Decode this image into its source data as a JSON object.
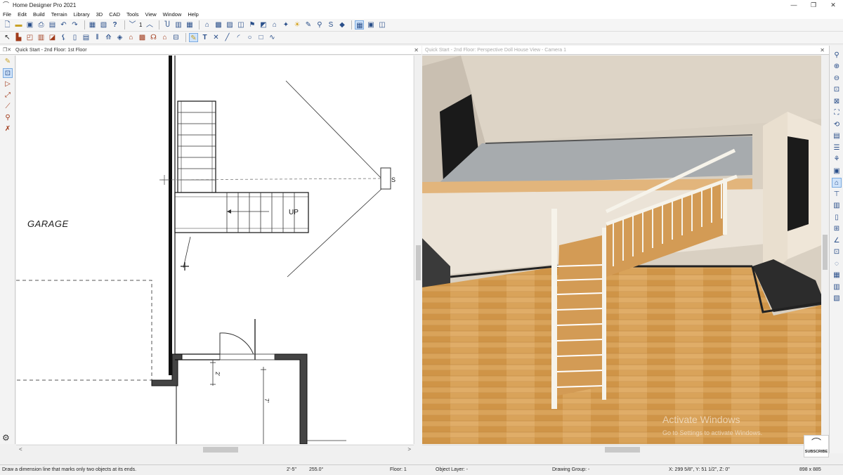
{
  "window": {
    "title": "Home Designer Pro 2021",
    "minimize": "—",
    "maximize": "❐",
    "close": "✕"
  },
  "menu": [
    "File",
    "Edit",
    "Build",
    "Terrain",
    "Library",
    "3D",
    "CAD",
    "Tools",
    "View",
    "Window",
    "Help"
  ],
  "toolbar1": {
    "layer_count": "1"
  },
  "left_pane": {
    "title": "Quick Start - 2nd Floor: 1st Floor",
    "plan": {
      "room_label": "GARAGE",
      "stair_label": "UP",
      "camera_marker": "S",
      "dim_small": "2'",
      "dim_large": "7'"
    }
  },
  "right_pane": {
    "title": "Quick Start - 2nd Floor: Perspective Doll House View - Camera 1"
  },
  "watermark": {
    "line1": "Activate Windows",
    "line2": "Go to Settings to activate Windows."
  },
  "subscribe": {
    "label": "SUBSCRIBE"
  },
  "status": {
    "hint": "Draw a dimension line that marks only two objects at its ends.",
    "length": "2'-5\"",
    "angle": "255.0°",
    "floor": "Floor: 1",
    "object_layer": "Object Layer: -",
    "drawing_group": "Drawing Group: -",
    "coords": "X: 299 5/8\", Y: 51 1/2\", Z: 0\"",
    "size": "898 x 885"
  },
  "colors": {
    "wall": "#222222",
    "floor_wood": "#d49a4a",
    "wall_3d": "#ebe3d7",
    "carpet": "#a9adb0"
  }
}
